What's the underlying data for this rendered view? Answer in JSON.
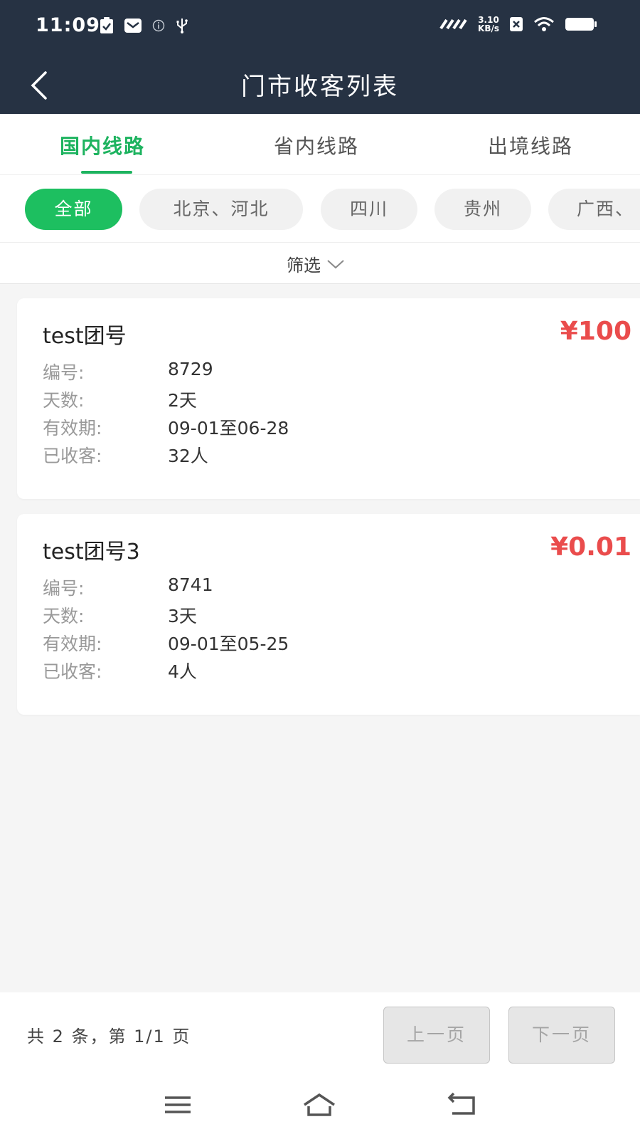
{
  "status_bar": {
    "time": "11:09",
    "net_speed_value": "3.10",
    "net_speed_unit": "KB/s"
  },
  "header": {
    "title": "门市收客列表"
  },
  "tabs": [
    {
      "label": "国内线路",
      "active": true
    },
    {
      "label": "省内线路",
      "active": false
    },
    {
      "label": "出境线路",
      "active": false
    }
  ],
  "regions": [
    {
      "label": "全部",
      "active": true
    },
    {
      "label": "北京、河北",
      "active": false
    },
    {
      "label": "四川",
      "active": false
    },
    {
      "label": "贵州",
      "active": false
    },
    {
      "label": "广西、",
      "active": false
    }
  ],
  "filter": {
    "label": "筛选"
  },
  "tours": [
    {
      "name": "test团号",
      "price": "¥100",
      "code_label": "编号:",
      "code": "8729",
      "days_label": "天数:",
      "days": "2天",
      "validity_label": "有效期:",
      "validity": "09-01至06-28",
      "collected_label": "已收客:",
      "collected": "32人"
    },
    {
      "name": "test团号3",
      "price": "¥0.01",
      "code_label": "编号:",
      "code": "8741",
      "days_label": "天数:",
      "days": "3天",
      "validity_label": "有效期:",
      "validity": "09-01至05-25",
      "collected_label": "已收客:",
      "collected": "4人"
    }
  ],
  "pagination": {
    "summary": "共 2 条，第 1/1 页",
    "prev_label": "上一页",
    "next_label": "下一页"
  },
  "colors": {
    "header_bg": "#263243",
    "accent_green": "#1db35f",
    "price_red": "#ea4c4c"
  },
  "icons": {
    "back": "chevron-left-icon",
    "filter_dropdown": "chevron-down-icon",
    "nav_menu": "menu-icon",
    "nav_home": "home-icon",
    "nav_back": "return-icon"
  }
}
